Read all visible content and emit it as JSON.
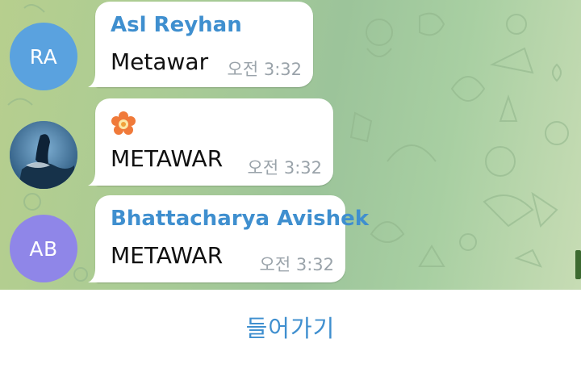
{
  "messages": [
    {
      "sender": "Asl Reyhan",
      "initials": "RA",
      "avatar_color": "#5aa2df",
      "text": "Metawar",
      "time": "오전 3:32"
    },
    {
      "sender": "",
      "initials": "",
      "avatar_type": "photo",
      "text": "METAWAR",
      "time": "오전 3:32",
      "emoji": "flower-icon"
    },
    {
      "sender": "Bhattacharya Avishek",
      "initials": "AB",
      "avatar_color": "#8f86e8",
      "text": "METAWAR",
      "time": "오전 3:32"
    }
  ],
  "bottom_bar": {
    "join_label": "들어가기"
  },
  "colors": {
    "sender_name": "#3f8fcf",
    "accent": "#3f8fcf",
    "time_text": "#9aa3aa"
  }
}
